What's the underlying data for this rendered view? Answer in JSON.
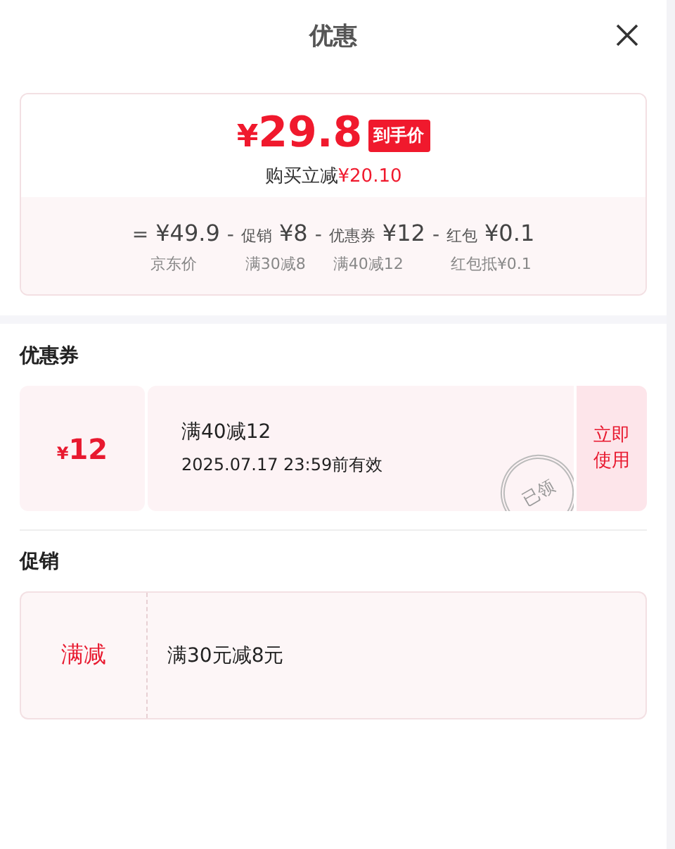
{
  "header": {
    "title": "优惠"
  },
  "summary": {
    "currency": "¥",
    "price": "29.8",
    "price_tag": "到手价",
    "saving_label": "购买立减",
    "saving_value": "¥20.10",
    "breakdown": [
      {
        "operator": "=",
        "value": "¥49.9",
        "note": "京东价"
      },
      {
        "operator": "-",
        "label": "促销",
        "value": "¥8",
        "note": "满30减8"
      },
      {
        "operator": "-",
        "label": "优惠券",
        "value": "¥12",
        "note": "满40减12"
      },
      {
        "operator": "-",
        "label": "红包",
        "value": "¥0.1",
        "note": "红包抵¥0.1"
      }
    ]
  },
  "coupons": {
    "title": "优惠券",
    "items": [
      {
        "currency": "¥",
        "amount": "12",
        "condition": "满40减12",
        "validity": "2025.07.17 23:59前有效",
        "stamp": "已领",
        "action": "立即使用"
      }
    ]
  },
  "promotions": {
    "title": "促销",
    "items": [
      {
        "type": "满减",
        "description": "满30元减8元"
      }
    ]
  }
}
